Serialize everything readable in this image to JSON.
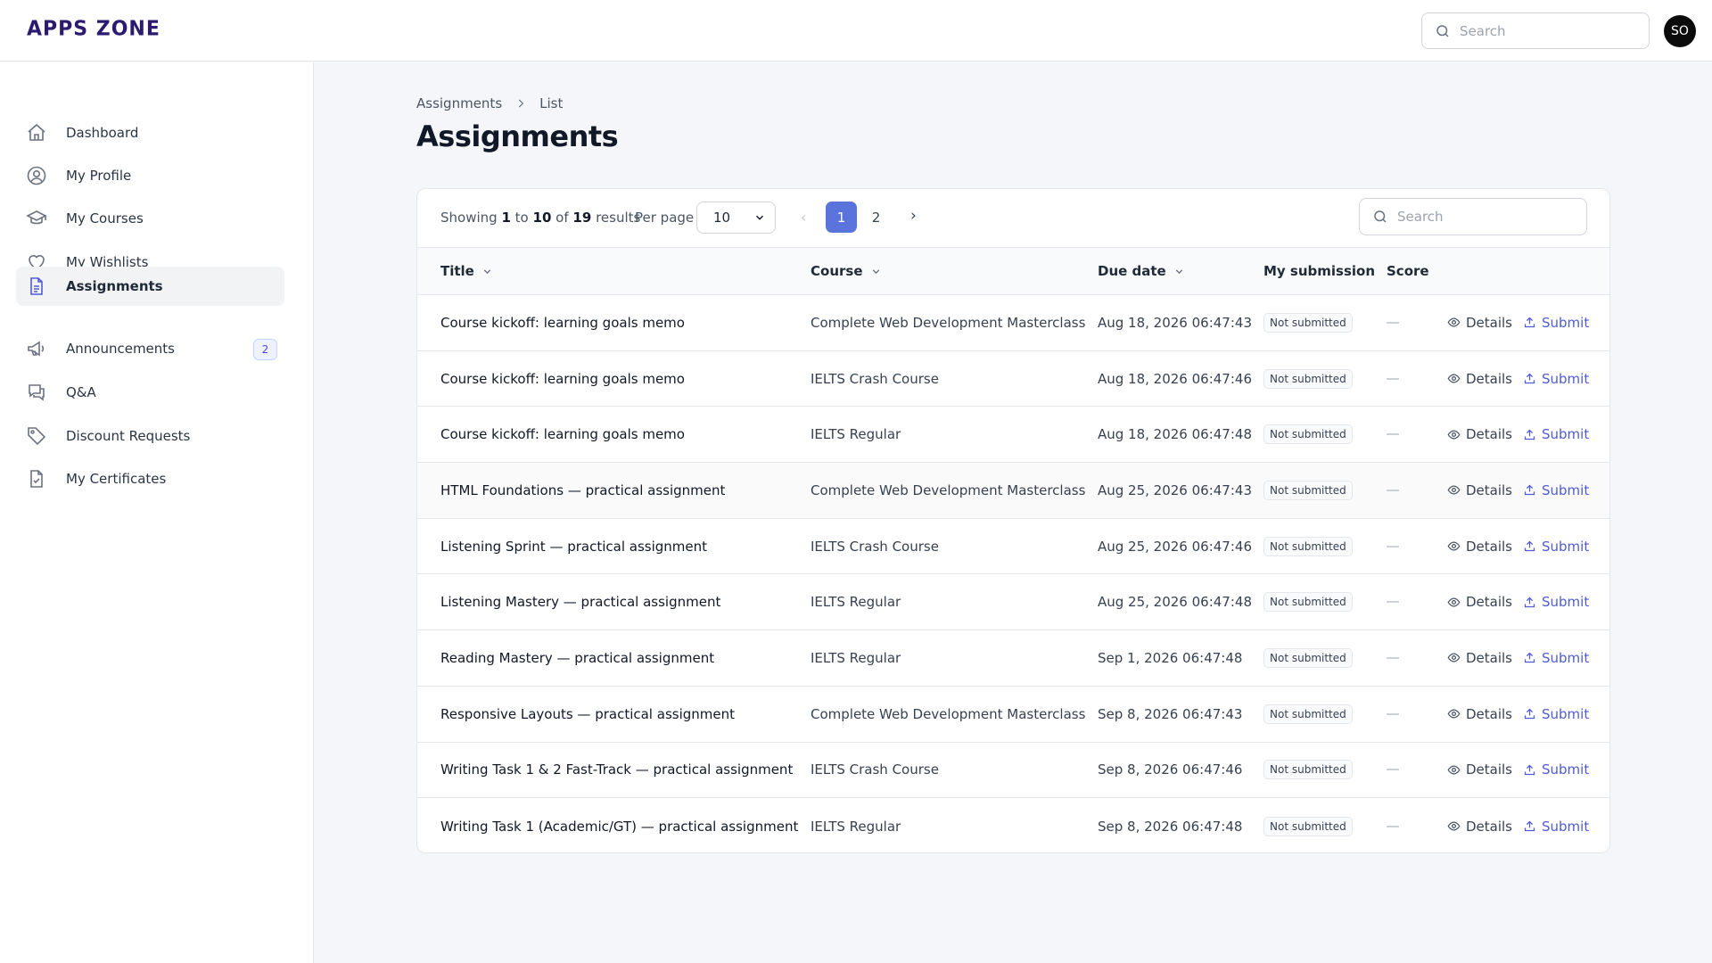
{
  "app": {
    "logo": "APPS ZONE",
    "avatar_initials": "SO"
  },
  "header": {
    "search_placeholder": "Search"
  },
  "sidebar": {
    "items": [
      {
        "label": "Dashboard",
        "icon": "home-icon"
      },
      {
        "label": "My Profile",
        "icon": "user-circle-icon"
      },
      {
        "label": "My Courses",
        "icon": "graduation-cap-icon"
      },
      {
        "label": "My Wishlists",
        "icon": "heart-icon"
      },
      {
        "label": "Assignments",
        "icon": "document-icon",
        "active": true
      },
      {
        "label": "Announcements",
        "icon": "megaphone-icon",
        "badge": "2"
      },
      {
        "label": "Q&A",
        "icon": "chat-bubbles-icon"
      },
      {
        "label": "Discount Requests",
        "icon": "tag-icon"
      },
      {
        "label": "My Certificates",
        "icon": "certificate-icon"
      }
    ]
  },
  "breadcrumb": {
    "root": "Assignments",
    "current": "List"
  },
  "page": {
    "title": "Assignments"
  },
  "toolbar": {
    "showing_prefix": "Showing",
    "from": "1",
    "to_word": "to",
    "to": "10",
    "of_word": "of",
    "total": "19",
    "results_word": "results",
    "per_page_label": "Per page",
    "per_page_value": "10",
    "prev_glyph": "‹",
    "next_glyph": "›",
    "pages": [
      "1",
      "2"
    ],
    "current_page": "1",
    "search_placeholder": "Search"
  },
  "table": {
    "columns": {
      "title": "Title",
      "course": "Course",
      "due_date": "Due date",
      "my_submission": "My submission",
      "score": "Score"
    },
    "details_label": "Details",
    "submit_label": "Submit",
    "rows": [
      {
        "title": "Course kickoff: learning goals memo",
        "course": "Complete Web Development Masterclass",
        "due": "Aug 18, 2026 06:47:43",
        "submission": "Not submitted"
      },
      {
        "title": "Course kickoff: learning goals memo",
        "course": "IELTS Crash Course",
        "due": "Aug 18, 2026 06:47:46",
        "submission": "Not submitted"
      },
      {
        "title": "Course kickoff: learning goals memo",
        "course": "IELTS Regular",
        "due": "Aug 18, 2026 06:47:48",
        "submission": "Not submitted"
      },
      {
        "title": "HTML Foundations — practical assignment",
        "course": "Complete Web Development Masterclass",
        "due": "Aug 25, 2026 06:47:43",
        "submission": "Not submitted"
      },
      {
        "title": "Listening Sprint — practical assignment",
        "course": "IELTS Crash Course",
        "due": "Aug 25, 2026 06:47:46",
        "submission": "Not submitted"
      },
      {
        "title": "Listening Mastery — practical assignment",
        "course": "IELTS Regular",
        "due": "Aug 25, 2026 06:47:48",
        "submission": "Not submitted"
      },
      {
        "title": "Reading Mastery — practical assignment",
        "course": "IELTS Regular",
        "due": "Sep 1, 2026 06:47:48",
        "submission": "Not submitted"
      },
      {
        "title": "Responsive Layouts — practical assignment",
        "course": "Complete Web Development Masterclass",
        "due": "Sep 8, 2026 06:47:43",
        "submission": "Not submitted"
      },
      {
        "title": "Writing Task 1 & 2 Fast-Track — practical assignment",
        "course": "IELTS Crash Course",
        "due": "Sep 8, 2026 06:47:46",
        "submission": "Not submitted"
      },
      {
        "title": "Writing Task 1 (Academic/GT) — practical assignment",
        "course": "IELTS Regular",
        "due": "Sep 8, 2026 06:47:48",
        "submission": "Not submitted"
      }
    ]
  },
  "colors": {
    "accent": "#5a74dc",
    "submit_link": "#4f5bd5",
    "logo": "#2b1a6e"
  }
}
